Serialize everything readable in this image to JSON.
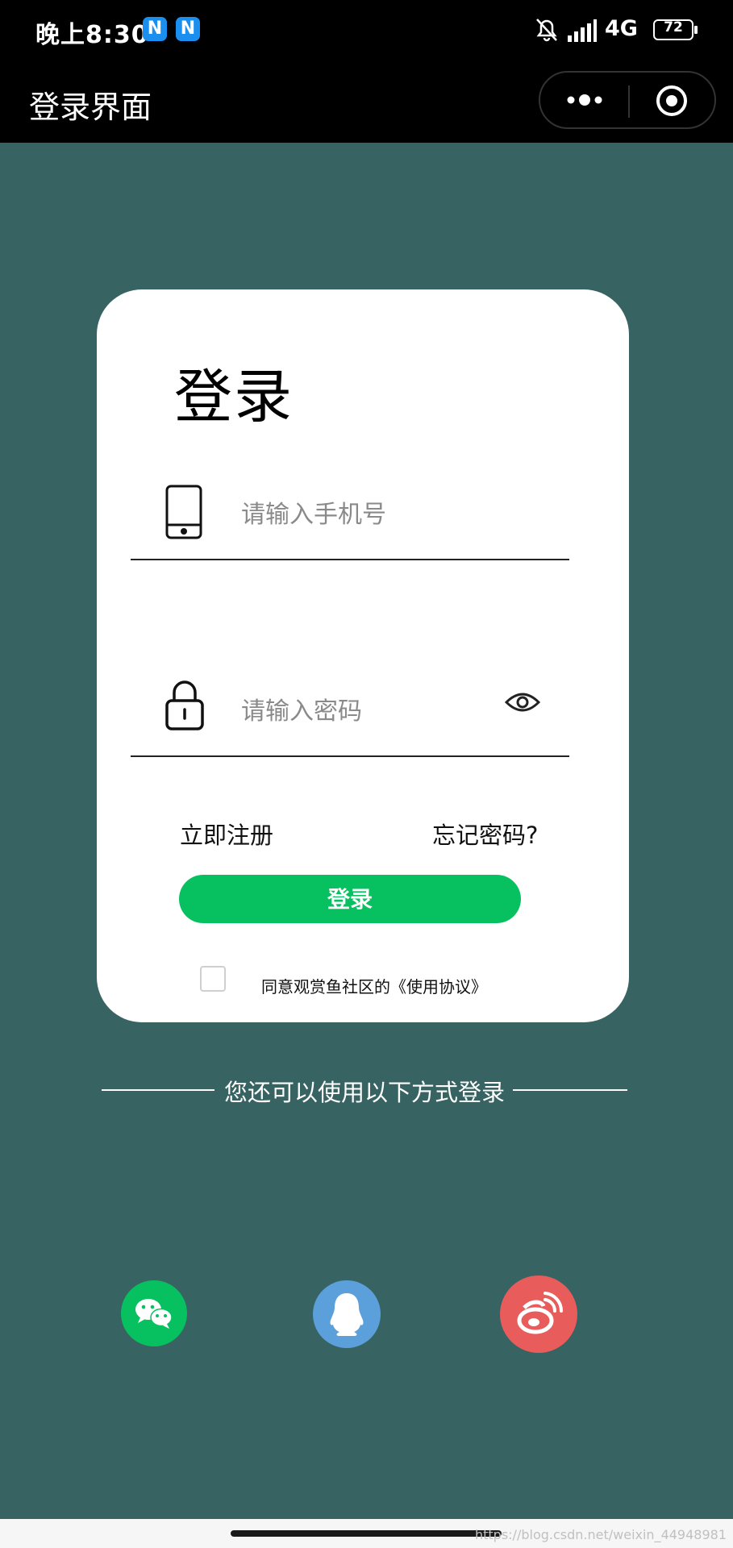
{
  "status_bar": {
    "time": "晚上8:30",
    "notification_badges": [
      "N",
      "N"
    ],
    "network": "4G",
    "battery": "72"
  },
  "nav": {
    "title": "登录界面"
  },
  "card": {
    "title": "登录",
    "phone_placeholder": "请输入手机号",
    "password_placeholder": "请输入密码",
    "register_link": "立即注册",
    "forgot_link": "忘记密码?",
    "login_button": "登录",
    "agreement_text": "同意观赏鱼社区的《使用协议》"
  },
  "alternative_login": {
    "label": "您还可以使用以下方式登录",
    "providers": [
      {
        "name": "wechat",
        "icon": "wechat-icon",
        "color": "#07c160"
      },
      {
        "name": "qq",
        "icon": "qq-icon",
        "color": "#5b9fdb"
      },
      {
        "name": "weibo",
        "icon": "weibo-icon",
        "color": "#e85c5c"
      }
    ]
  },
  "watermark": "https://blog.csdn.net/weixin_44948981",
  "colors": {
    "background": "#376362",
    "primary_button": "#07c160"
  }
}
